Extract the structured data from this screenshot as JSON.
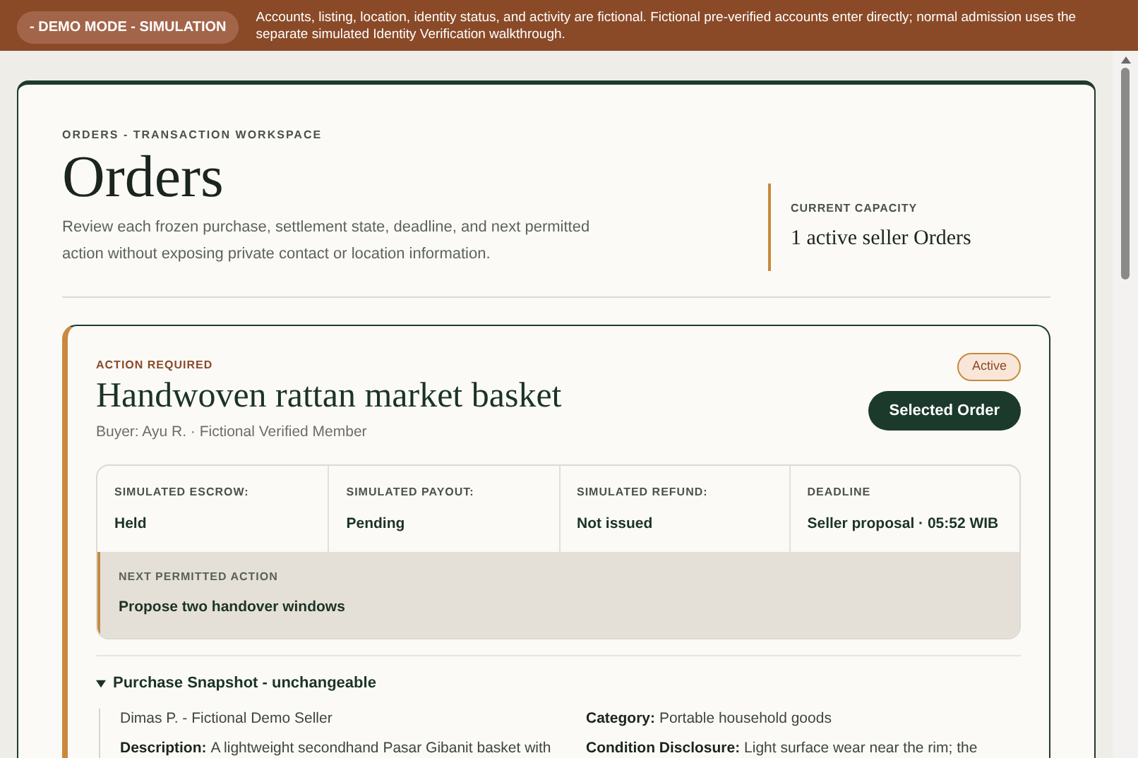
{
  "banner": {
    "badge": "- DEMO MODE - SIMULATION",
    "text": "Accounts, listing, location, identity status, and activity are fictional. Fictional pre-verified accounts enter directly; normal admission uses the separate simulated Identity Verification walkthrough."
  },
  "header": {
    "eyebrow": "ORDERS - TRANSACTION WORKSPACE",
    "title": "Orders",
    "description": "Review each frozen purchase, settlement state, deadline, and next permitted action without exposing private contact or location information.",
    "capacity_label": "CURRENT CAPACITY",
    "capacity_value": "1 active seller Orders"
  },
  "order": {
    "flag": "ACTION REQUIRED",
    "title": "Handwoven rattan market basket",
    "buyer": "Buyer: Ayu R. · Fictional Verified Member",
    "status": "Active",
    "button": "Selected Order",
    "selected": true,
    "summary": [
      {
        "label": "SIMULATED ESCROW:",
        "value": "Held"
      },
      {
        "label": "SIMULATED PAYOUT:",
        "value": "Pending"
      },
      {
        "label": "SIMULATED REFUND:",
        "value": "Not issued"
      },
      {
        "label": "DEADLINE",
        "value": "Seller proposal · 05:52 WIB"
      }
    ],
    "next_action": {
      "label": "NEXT PERMITTED ACTION",
      "value": "Propose two handover windows"
    },
    "snapshot": {
      "title": "Purchase Snapshot - unchangeable",
      "expanded": true,
      "fields": [
        {
          "value": "Dimas P. - Fictional Demo Seller"
        },
        {
          "label": "Category:",
          "value": "Portable household goods"
        },
        {
          "label": "Description:",
          "value": "A lightweight secondhand Pasar Gibanit basket with"
        },
        {
          "label": "Condition Disclosure:",
          "value": "Light surface wear near the rim; the"
        }
      ]
    }
  }
}
